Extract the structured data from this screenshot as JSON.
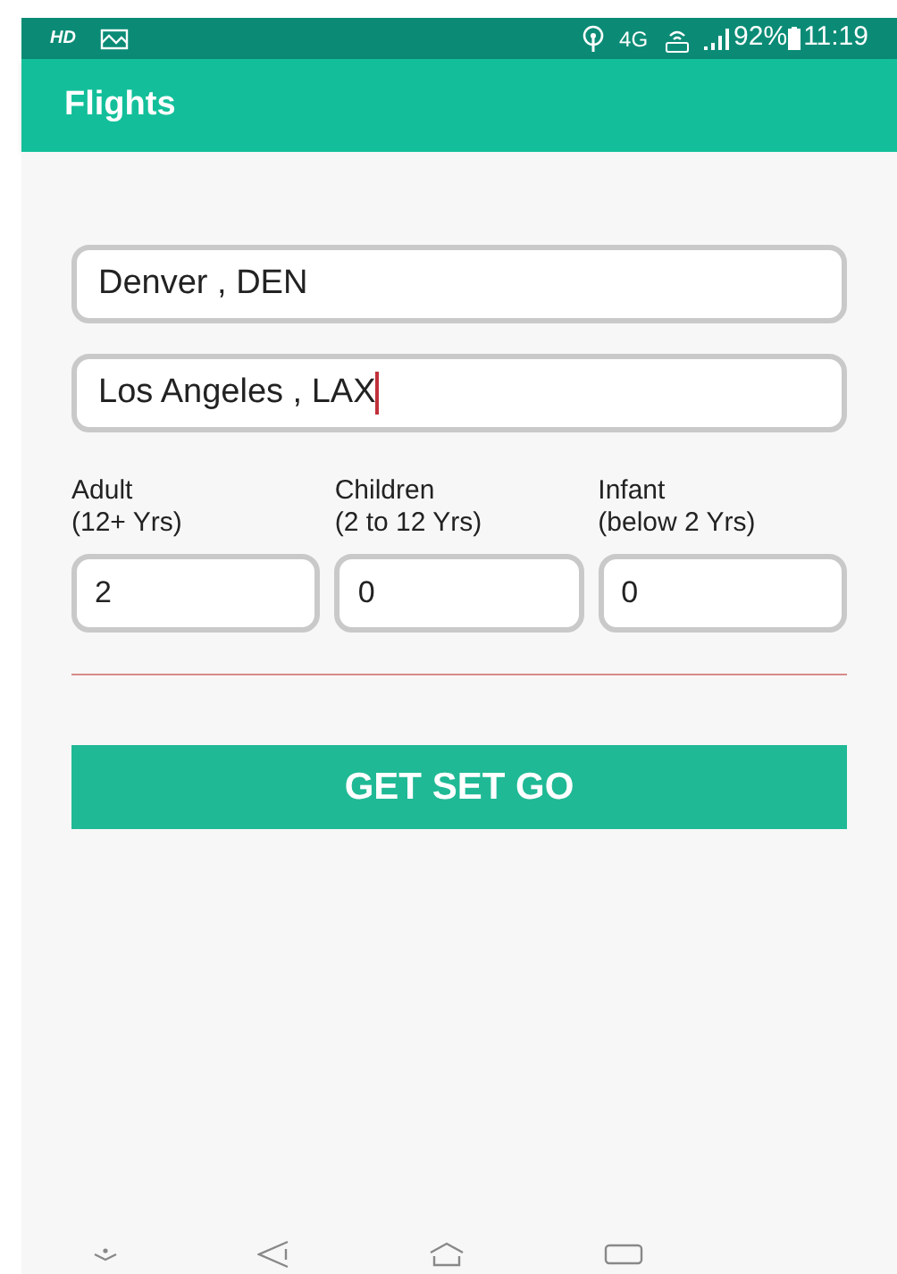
{
  "status_bar": {
    "hd": "HD",
    "network": "4G",
    "battery": "92%",
    "time": "11:19"
  },
  "app_bar": {
    "title": "Flights"
  },
  "route_fields": [
    {
      "value": "Denver , DEN",
      "focused": false
    },
    {
      "value": "Los Angeles , LAX",
      "focused": true
    }
  ],
  "passengers": [
    {
      "label": "Adult",
      "range": "(12+ Yrs)",
      "value": "2"
    },
    {
      "label": "Children",
      "range": "(2 to 12 Yrs)",
      "value": "0"
    },
    {
      "label": "Infant",
      "range": "(below 2 Yrs)",
      "value": "0"
    }
  ],
  "submit_button": {
    "label": "GET SET GO"
  }
}
